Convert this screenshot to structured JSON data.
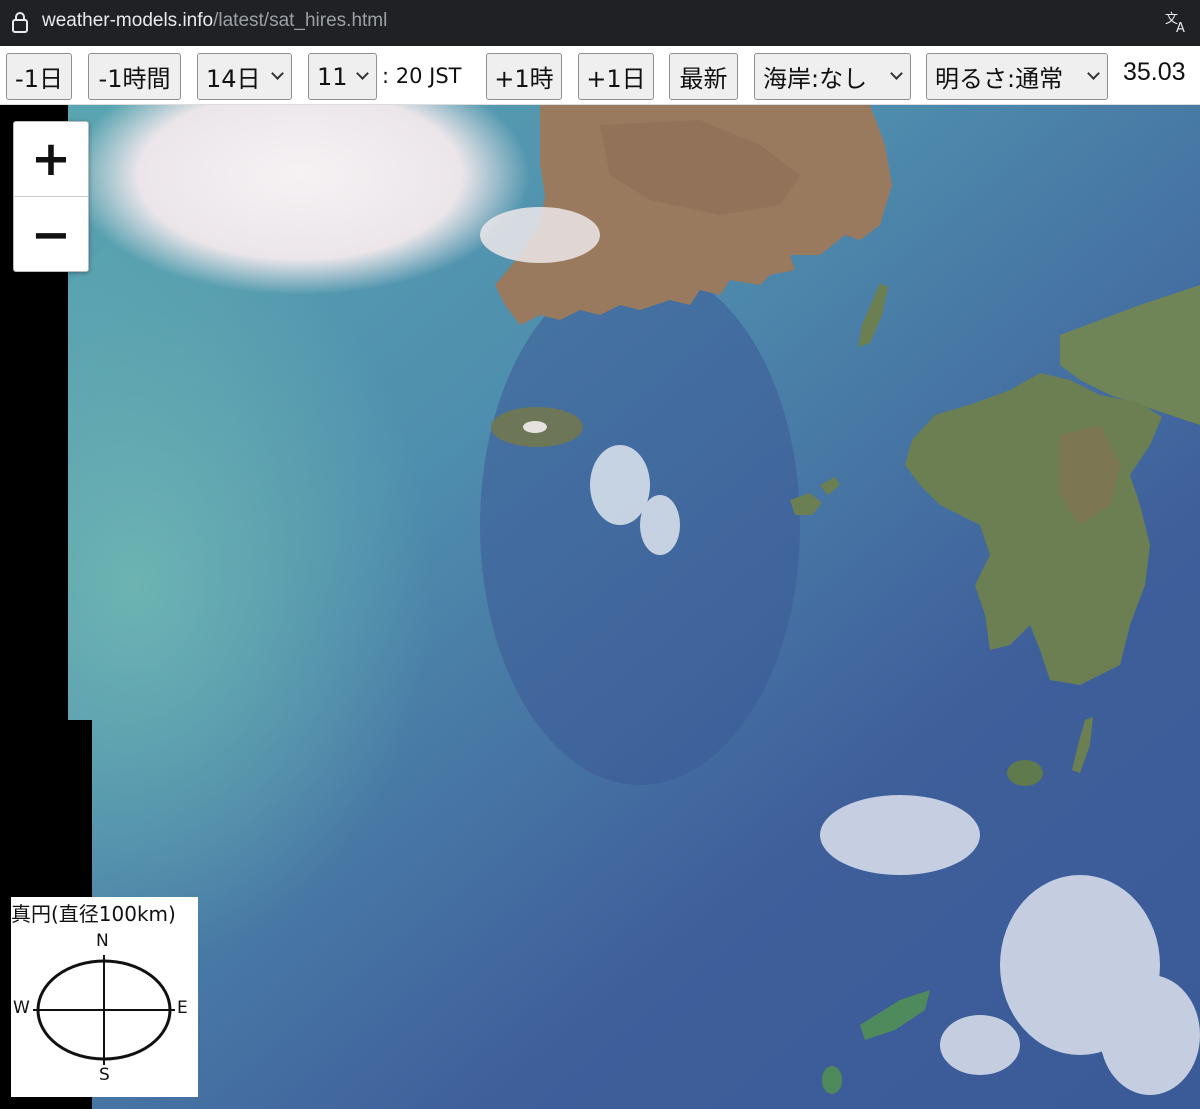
{
  "browser": {
    "url_host": "weather-models.info",
    "url_path": "/latest/sat_hires.html"
  },
  "toolbar": {
    "minus_day": "-1日",
    "minus_hour": "-1時間",
    "day_select": "14日",
    "hour_select": "11",
    "minute_text": ": 20 JST",
    "plus_hour": "+1時",
    "plus_day": "+1日",
    "latest": "最新",
    "coast_select": "海岸:なし",
    "brightness_select": "明るさ:通常",
    "coords": "35.03"
  },
  "map": {
    "zoom_in": "+",
    "zoom_out": "−",
    "scale_title": "真円(直径100km)",
    "dir_n": "N",
    "dir_s": "S",
    "dir_w": "W",
    "dir_e": "E"
  },
  "colors": {
    "sea_deep": "#3f5f9b",
    "sea_turbid": "#5aa3b0",
    "land": "#6b7f52",
    "land_korea": "#9a7a5e",
    "cloud": "#f2eef0"
  }
}
